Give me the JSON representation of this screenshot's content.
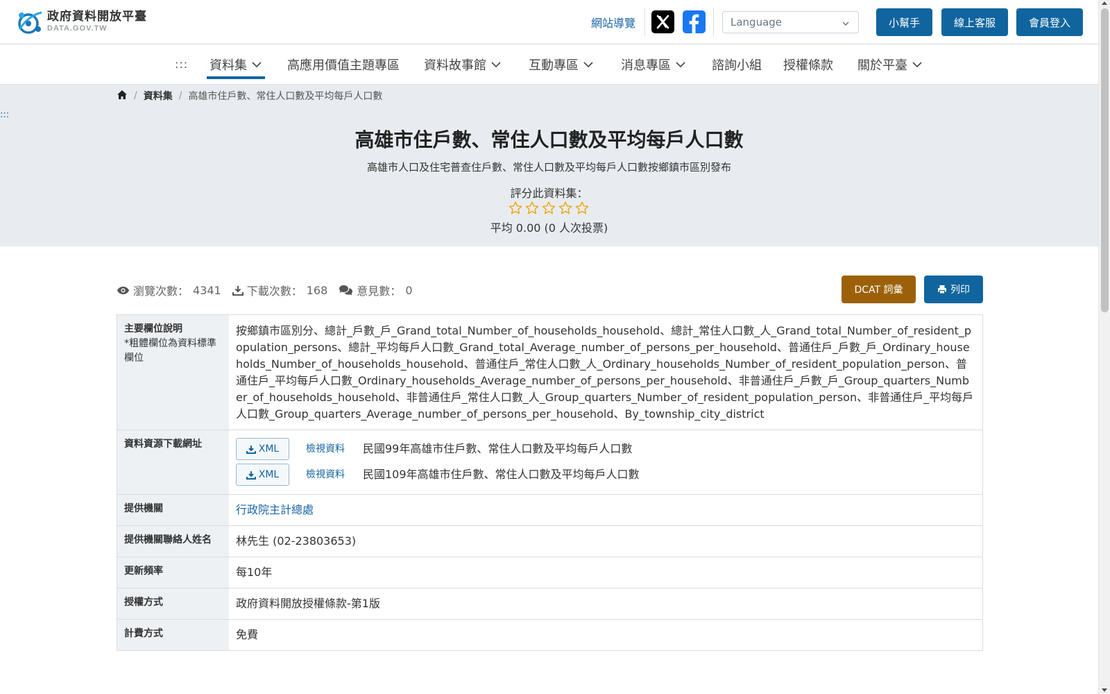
{
  "header": {
    "logo_cn": "政府資料開放平臺",
    "logo_en": "DATA.GOV.TW",
    "sitemap": "網站導覽",
    "language_placeholder": "Language",
    "buttons": [
      "小幫手",
      "線上客服",
      "會員登入"
    ],
    "brand_color": "#11659f"
  },
  "nav": {
    "skip": ":::",
    "items": [
      {
        "label": "資料集",
        "dropdown": true,
        "active": true
      },
      {
        "label": "高應用價值主題專區",
        "dropdown": false
      },
      {
        "label": "資料故事館",
        "dropdown": true
      },
      {
        "label": "互動專區",
        "dropdown": true
      },
      {
        "label": "消息專區",
        "dropdown": true
      },
      {
        "label": "諮詢小組",
        "dropdown": false
      },
      {
        "label": "授權條款",
        "dropdown": false
      },
      {
        "label": "關於平臺",
        "dropdown": true
      }
    ]
  },
  "breadcrumb": {
    "items": [
      "資料集",
      "高雄市住戶數、常住人口數及平均每戶人口數"
    ]
  },
  "side_marker": ":::",
  "dataset": {
    "title": "高雄市住戶數、常住人口數及平均每戶人口數",
    "subtitle": "高雄市人口及住宅普查住戶數、常住人口數及平均每戶人口數按鄉鎮市區別發布",
    "rate_label": "評分此資料集：",
    "rating_value": 0,
    "rating_max": 5,
    "average": "平均 0.00 (0 人次投票)"
  },
  "stats": {
    "views_label": "瀏覽次數：",
    "views": "4341",
    "downloads_label": "下載次數：",
    "downloads": "168",
    "comments_label": "意見數：",
    "comments": "0"
  },
  "actions": {
    "dcat": "DCAT 詞彙",
    "print": "列印",
    "dcat_color": "#9c6108"
  },
  "table": {
    "fields_label": "主要欄位說明",
    "fields_note": "*粗體欄位為資料標準欄位",
    "fields_text": "按鄉鎮市區別分、總計_戶數_戶_Grand_total_Number_of_households_household、總計_常住人口數_人_Grand_total_Number_of_resident_population_persons、總計_平均每戶人口數_Grand_total_Average_number_of_persons_per_household、普通住戶_戶數_戶_Ordinary_households_Number_of_households_household、普通住戶_常住人口數_人_Ordinary_households_Number_of_resident_population_person、普通住戶_平均每戶人口數_Ordinary_households_Average_number_of_persons_per_household、非普通住戶_戶數_戶_Group_quarters_Number_of_households_household、非普通住戶_常住人口數_人_Group_quarters_Number_of_resident_population_person、非普通住戶_平均每戶人口數_Group_quarters_Average_number_of_persons_per_household、By_township_city_district",
    "resources_label": "資料資源下載網址",
    "resources": [
      {
        "format": "XML",
        "view": "檢視資料",
        "name": "民國99年高雄市住戶數、常住人口數及平均每戶人口數"
      },
      {
        "format": "XML",
        "view": "檢視資料",
        "name": "民國109年高雄市住戶數、常住人口數及平均每戶人口數"
      }
    ],
    "agency_label": "提供機關",
    "agency": "行政院主計總處",
    "contact_label": "提供機關聯絡人姓名",
    "contact": "林先生 (02-23803653)",
    "frequency_label": "更新頻率",
    "frequency": "每10年",
    "license_label": "授權方式",
    "license": "政府資料開放授權條款-第1版",
    "fee_label": "計費方式",
    "fee": "免費"
  }
}
